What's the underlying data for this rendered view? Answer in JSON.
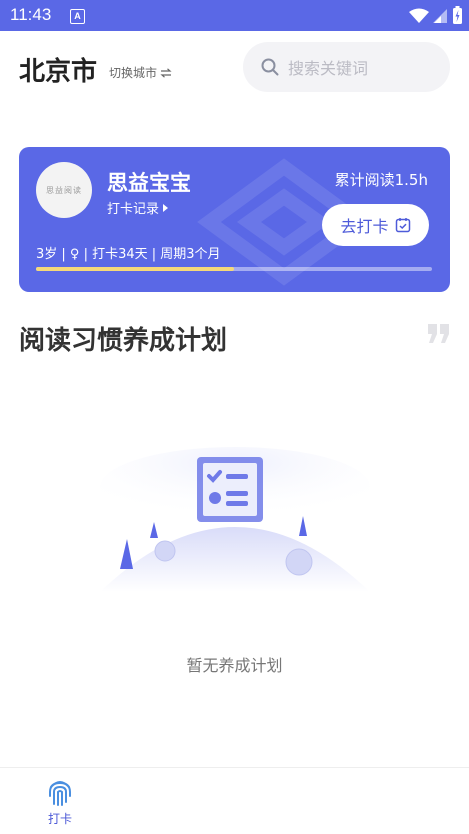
{
  "status_bar": {
    "time": "11:43",
    "notification_badge": "A",
    "bg_color": "#5a68e6"
  },
  "header": {
    "city": "北京市",
    "switch_city_label": "切换城市",
    "search_placeholder": "搜索关键词"
  },
  "child_card": {
    "avatar_text": "思益阅读",
    "name": "思益宝宝",
    "checkin_record_label": "打卡记录",
    "reading_total": "累计阅读1.5h",
    "checkin_button_label": "去打卡",
    "info": "3岁 | ♀ | 打卡34天 | 周期3个月",
    "progress_fraction": 0.5,
    "accent_color": "#5a68e6",
    "progress_color": "#f4d97a"
  },
  "plan_section": {
    "title": "阅读习惯养成计划",
    "empty_text": "暂无养成计划"
  },
  "tab_bar": {
    "items": [
      {
        "label": "打卡",
        "icon": "fingerprint-icon",
        "active": true
      }
    ]
  }
}
